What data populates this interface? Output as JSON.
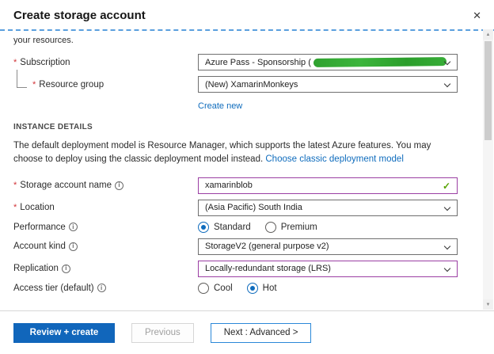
{
  "header": {
    "title": "Create storage account"
  },
  "glyphs": {
    "required": "*",
    "info": "i",
    "close": "✕",
    "check": "✓",
    "scroll_up": "▲",
    "scroll_down": "▼"
  },
  "scroll_hint_text": "your resources.",
  "basics": {
    "subscription": {
      "label": "Subscription",
      "value": "Azure Pass - Sponsorship ("
    },
    "resource_group": {
      "label": "Resource group",
      "value": "(New) XamarinMonkeys",
      "create_new_label": "Create new"
    }
  },
  "instance_details": {
    "section_title": "INSTANCE DETAILS",
    "description": "The default deployment model is Resource Manager, which supports the latest Azure features. You may choose to deploy using the classic deployment model instead.",
    "deployment_link": "Choose classic deployment model",
    "storage_account_name": {
      "label": "Storage account name",
      "value": "xamarinblob"
    },
    "location": {
      "label": "Location",
      "value": "(Asia Pacific) South India"
    },
    "performance": {
      "label": "Performance",
      "options": [
        {
          "label": "Standard",
          "selected": true
        },
        {
          "label": "Premium",
          "selected": false
        }
      ]
    },
    "account_kind": {
      "label": "Account kind",
      "value": "StorageV2 (general purpose v2)"
    },
    "replication": {
      "label": "Replication",
      "value": "Locally-redundant storage (LRS)"
    },
    "access_tier": {
      "label": "Access tier (default)",
      "options": [
        {
          "label": "Cool",
          "selected": false
        },
        {
          "label": "Hot",
          "selected": true
        }
      ]
    }
  },
  "footer": {
    "review_create_label": "Review + create",
    "previous_label": "Previous",
    "next_label": "Next : Advanced >"
  }
}
